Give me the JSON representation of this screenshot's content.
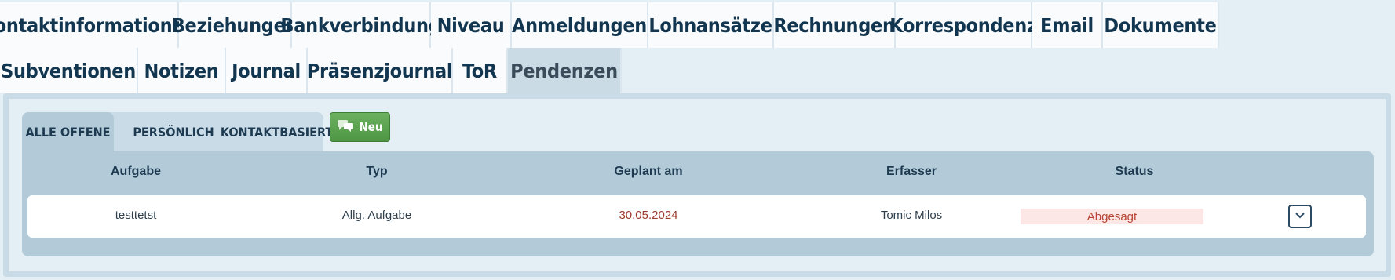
{
  "main_tabs_row1": [
    {
      "label": "Kontaktinformationen"
    },
    {
      "label": "Beziehungen"
    },
    {
      "label": "Bankverbindung"
    },
    {
      "label": "Niveau"
    },
    {
      "label": "Anmeldungen"
    },
    {
      "label": "Lohnansätze"
    },
    {
      "label": "Rechnungen"
    },
    {
      "label": "Korrespondenz"
    },
    {
      "label": "Email"
    },
    {
      "label": "Dokumente"
    }
  ],
  "main_tabs_row2": [
    {
      "label": "Subventionen"
    },
    {
      "label": "Notizen"
    },
    {
      "label": "Journal"
    },
    {
      "label": "Präsenzjournal"
    },
    {
      "label": "ToR"
    },
    {
      "label": "Pendenzen",
      "active": true
    }
  ],
  "subtabs": [
    {
      "label": "ALLE OFFENE",
      "active": true
    },
    {
      "label": "PERSÖNLICH"
    },
    {
      "label": "KONTAKTBASIERT"
    }
  ],
  "new_button": {
    "label": "Neu",
    "icon": "chat-bubbles-icon"
  },
  "table": {
    "columns": [
      "Aufgabe",
      "Typ",
      "Geplant am",
      "Erfasser",
      "Status"
    ],
    "rows": [
      {
        "aufgabe": "testtetst",
        "typ": "Allg. Aufgabe",
        "geplant_am": "30.05.2024",
        "erfasser": "Tomic Milos",
        "status": "Abgesagt"
      }
    ]
  },
  "colors": {
    "accent_dark": "#133650",
    "status_cancelled": "#b64535",
    "status_cancelled_bg": "#fde6e6",
    "button_green": "#5aa34f"
  }
}
